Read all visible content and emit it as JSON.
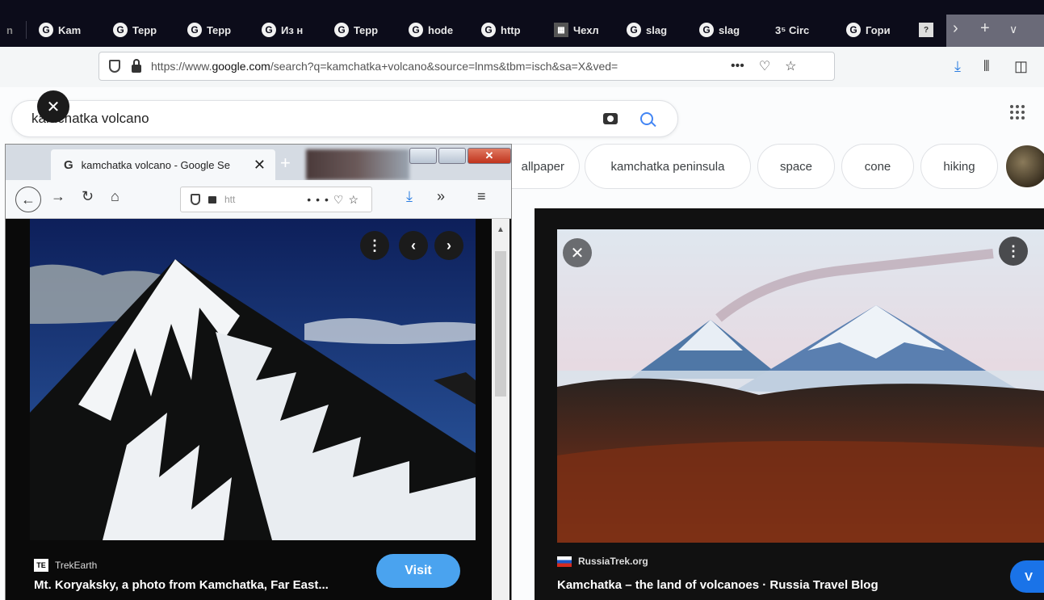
{
  "tabs": [
    {
      "label": "Kam",
      "icon": "google-icon"
    },
    {
      "label": "Tepp",
      "icon": "google-icon"
    },
    {
      "label": "Tepp",
      "icon": "google-icon"
    },
    {
      "label": "Из н",
      "icon": "google-icon"
    },
    {
      "label": "Tepp",
      "icon": "google-icon"
    },
    {
      "label": "hode",
      "icon": "google-icon"
    },
    {
      "label": "http",
      "icon": "google-icon"
    },
    {
      "label": "Чехл",
      "icon": "page-icon"
    },
    {
      "label": "slag",
      "icon": "google-icon"
    },
    {
      "label": "slag",
      "icon": "google-icon"
    },
    {
      "label": "3⁵ Circ",
      "icon": "none"
    },
    {
      "label": "Гори",
      "icon": "google-icon"
    }
  ],
  "address_bar": {
    "url_prefix": "https://www.",
    "url_domain": "google.com",
    "url_rest": "/search?q=kamchatka+volcano&source=lnms&tbm=isch&sa=X&ved=",
    "more": "•••"
  },
  "search": {
    "query": "kamchatka volcano"
  },
  "chips": [
    "allpaper",
    "kamchatka peninsula",
    "space",
    "cone",
    "hiking"
  ],
  "right_preview": {
    "source": "RussiaTrek.org",
    "title": "Kamchatka – the land of volcanoes · Russia Travel Blog",
    "visit": "V"
  },
  "small_window": {
    "tab_title": "kamchatka volcano - Google Se",
    "url_partial": "htt",
    "source": "TrekEarth",
    "source_badge": "TE",
    "title": "Mt. Koryaksky, a photo from Kamchatka, Far East...",
    "visit": "Visit"
  },
  "colors": {
    "tabstrip_bg": "#0c0c1a",
    "visit_blue": "#4aa3ef",
    "google_blue": "#4285f4"
  }
}
